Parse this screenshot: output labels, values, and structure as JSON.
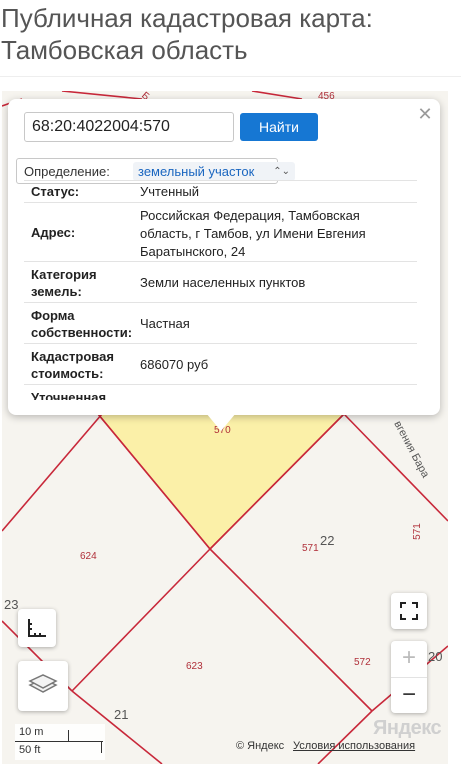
{
  "page": {
    "title_line1": "Публичная кадастровая карта:",
    "title_line2": "Тамбовская область"
  },
  "search": {
    "value": "68:20:4022004:570",
    "button_label": "Найти"
  },
  "definition": {
    "label": "Определение:",
    "selected": "земельный участок"
  },
  "info_rows": [
    {
      "label": "Статус:",
      "value": "Учтенный"
    },
    {
      "label": "Адрес:",
      "value_lines": [
        "Российская Федерация, Тамбовская",
        "область, г Тамбов, ул Имени Евгения",
        "Баратынского, 24"
      ]
    },
    {
      "label_lines": [
        "Категория",
        "земель:"
      ],
      "value": "Земли населенных пунктов"
    },
    {
      "label_lines": [
        "Форма",
        "собственности:"
      ],
      "value": "Частная"
    },
    {
      "label_lines": [
        "Кадастровая",
        "стоимость:"
      ],
      "value": "686070 руб"
    },
    {
      "label": "Уточненная"
    }
  ],
  "map": {
    "plots": [
      "456",
      "570",
      "624",
      "571",
      "22",
      "571",
      "623",
      "572",
      "21",
      "23",
      "20"
    ],
    "street_label": "вгения Бара",
    "top_label": "Б",
    "highlight_color": "#fbf0a8",
    "line_color": "#c8283a"
  },
  "scale": {
    "metric": "10 m",
    "imperial": "50 ft"
  },
  "footer": {
    "logo": "Яндекс",
    "copyright": "© Яндекс",
    "terms": "Условия использования"
  },
  "icons": {
    "close": "close-icon",
    "fullscreen": "fullscreen-icon",
    "ruler": "ruler-icon",
    "layers": "layers-icon"
  }
}
